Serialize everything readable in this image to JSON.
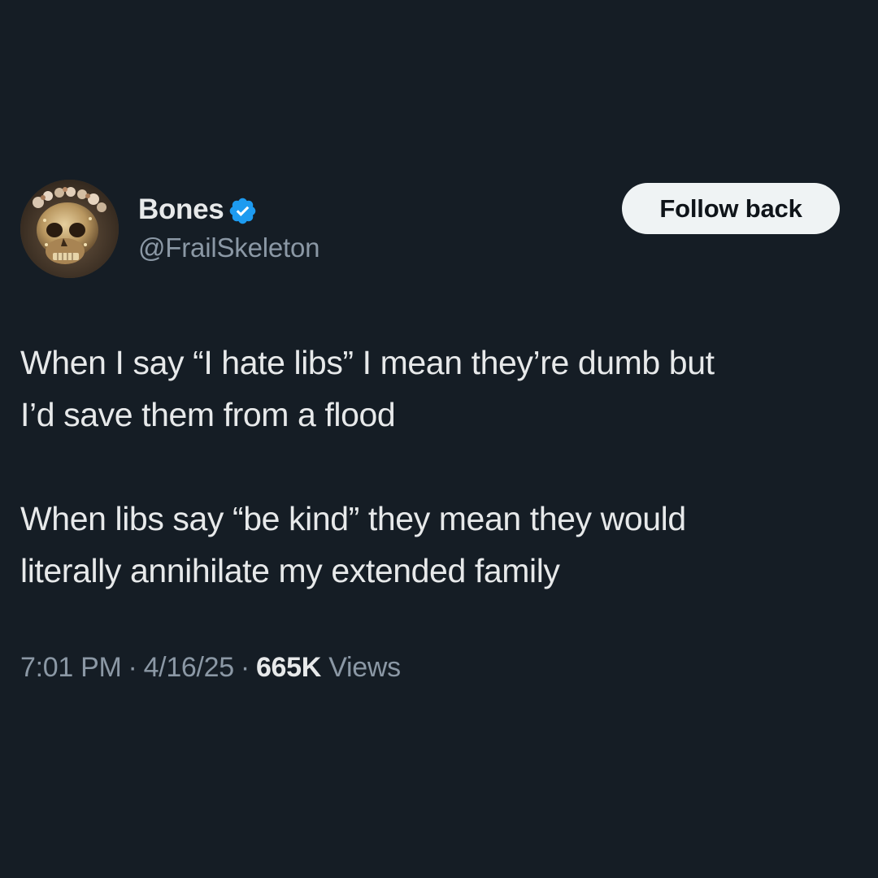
{
  "tweet": {
    "author": {
      "display_name": "Bones",
      "verified": true,
      "handle": "@FrailSkeleton"
    },
    "follow_button_label": "Follow back",
    "paragraphs": [
      "When I say “I hate libs” I mean they’re dumb but\nI’d save them from a flood",
      "When libs say “be kind” they mean they would\nliterally annihilate my extended family"
    ],
    "meta": {
      "time": "7:01 PM",
      "date": "4/16/25",
      "separator": "·",
      "views_count": "665K",
      "views_label": "Views"
    }
  },
  "icons": {
    "verified": "verified-badge-icon"
  },
  "colors": {
    "background": "#151d25",
    "primary_text": "#e7e9ea",
    "secondary_text": "#8b98a5",
    "verified_blue": "#1d9bf0",
    "button_bg": "#eff3f4",
    "button_text": "#0f1419"
  }
}
